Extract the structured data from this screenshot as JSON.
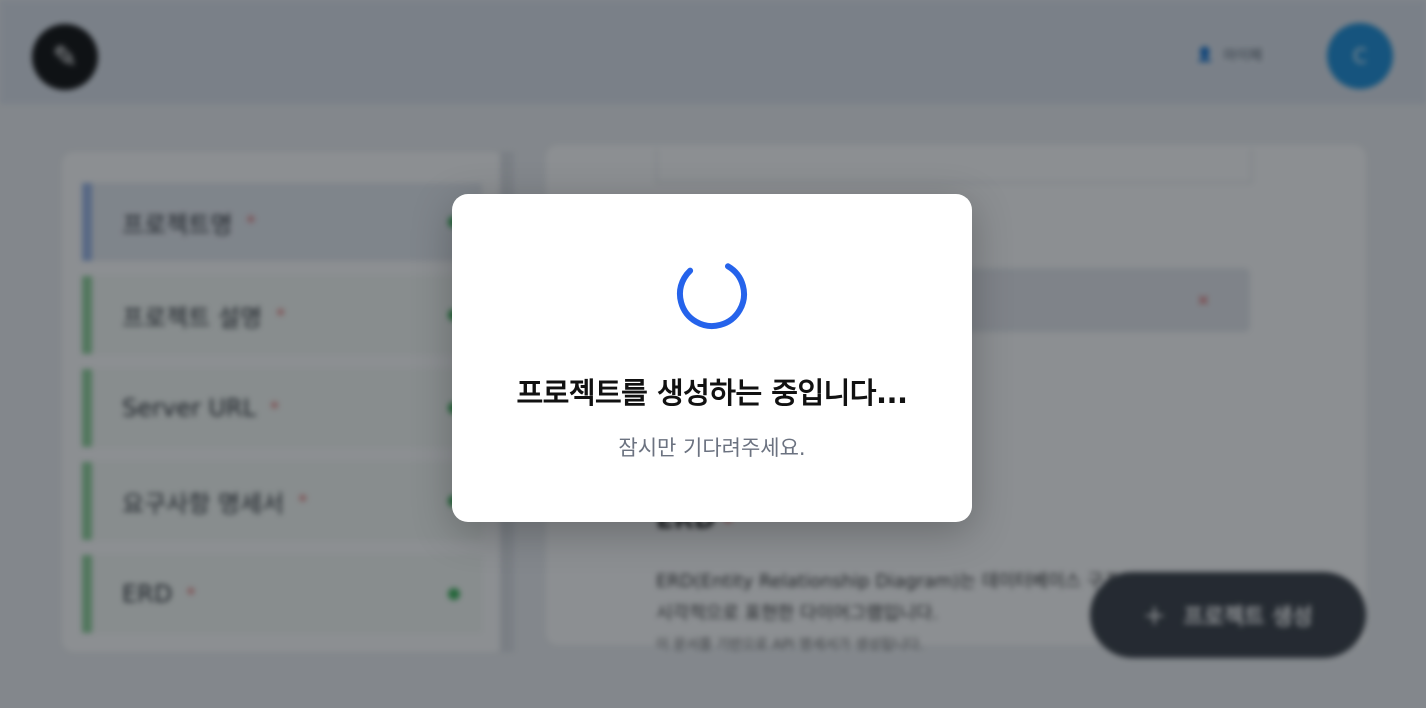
{
  "modal": {
    "title": "프로젝트를 생성하는 중입니다...",
    "subtitle": "잠시만 기다려주세요.",
    "spinner_icon": "loading-spinner-icon",
    "spinner_color": "#2563eb"
  },
  "header": {
    "logo_icon": "pen-logo-icon",
    "user_link": "마이페",
    "avatar_initial": "C"
  },
  "sidebar": {
    "items": [
      {
        "label": "프로젝트명",
        "required": "*"
      },
      {
        "label": "프로젝트 설명",
        "required": "*"
      },
      {
        "label": "Server URL",
        "required": "*"
      },
      {
        "label": "요구사항 명세서",
        "required": "*"
      },
      {
        "label": "ERD",
        "required": "*"
      }
    ]
  },
  "main": {
    "filled_value": "",
    "erd_label": "ERD",
    "erd_required": "*",
    "erd_description": "ERD(Entity Relationship Diagram)는 데이터베이스 구조를 시각적으로 표현한 다이어그램입니다.",
    "erd_subtext": "이 문서를 기반으로 API 명세서가 생성됩니다."
  },
  "fab": {
    "label": "프로젝트 생성"
  }
}
